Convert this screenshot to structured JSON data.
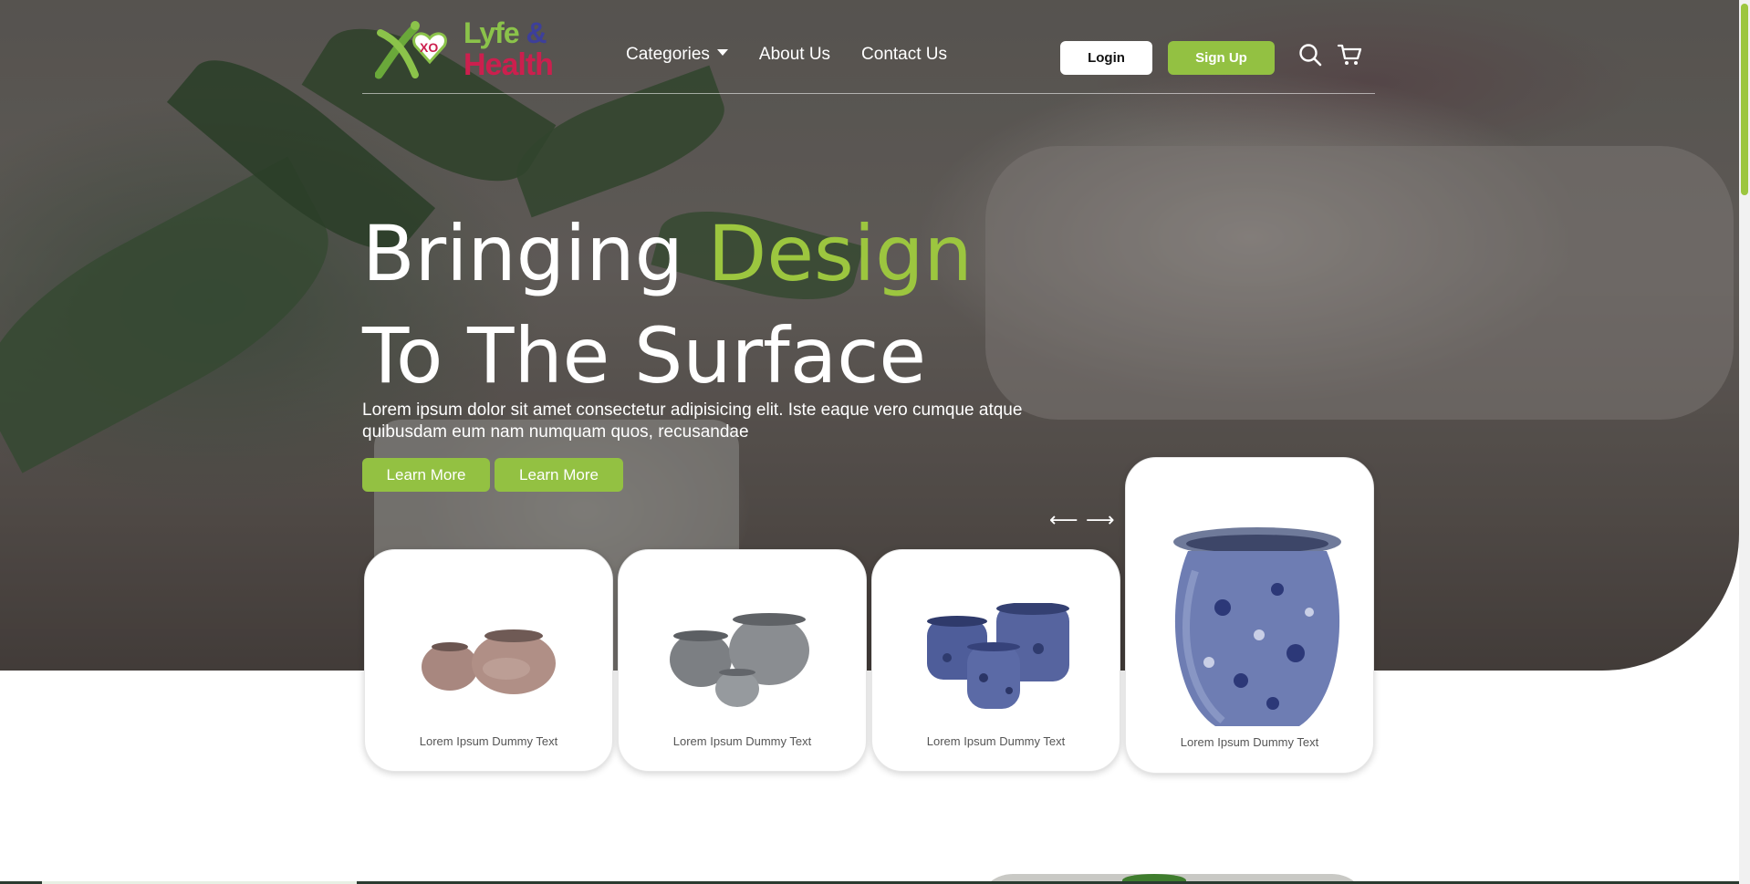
{
  "brand": {
    "logo_line1": "Lyfe",
    "logo_amp": "&",
    "logo_line2": "Health",
    "logo_badge": "XO"
  },
  "nav": {
    "items": [
      {
        "label": "Categories",
        "has_caret": true
      },
      {
        "label": "About Us"
      },
      {
        "label": "Contact Us"
      }
    ],
    "login_label": "Login",
    "signup_label": "Sign Up",
    "icons": [
      "search-icon",
      "cart-icon"
    ]
  },
  "hero": {
    "title_part1": "Bringing ",
    "title_accent": "Design",
    "title_line2": "To The Surface",
    "subtitle": "Lorem ipsum dolor sit amet consectetur adipisicing elit. Iste eaque vero cumque atque quibusdam eum nam numquam quos, recusandae",
    "buttons": [
      "Learn More",
      "Learn More"
    ]
  },
  "carousel": {
    "prev_glyph": "⟵",
    "next_glyph": "⟶",
    "cards": [
      {
        "label": "Lorem Ipsum Dummy Text",
        "image": "two-round-pots"
      },
      {
        "label": "Lorem Ipsum Dummy Text",
        "image": "three-grey-pots"
      },
      {
        "label": "Lorem Ipsum Dummy Text",
        "image": "three-blue-pots"
      },
      {
        "label": "Lorem Ipsum Dummy Text",
        "image": "blue-glazed-vase"
      }
    ]
  },
  "colors": {
    "accent": "#9cc63f",
    "button_green": "#93c142",
    "logo_green": "#8bc34a",
    "logo_red": "#cc1f4e",
    "logo_blue": "#3d3f9a"
  }
}
